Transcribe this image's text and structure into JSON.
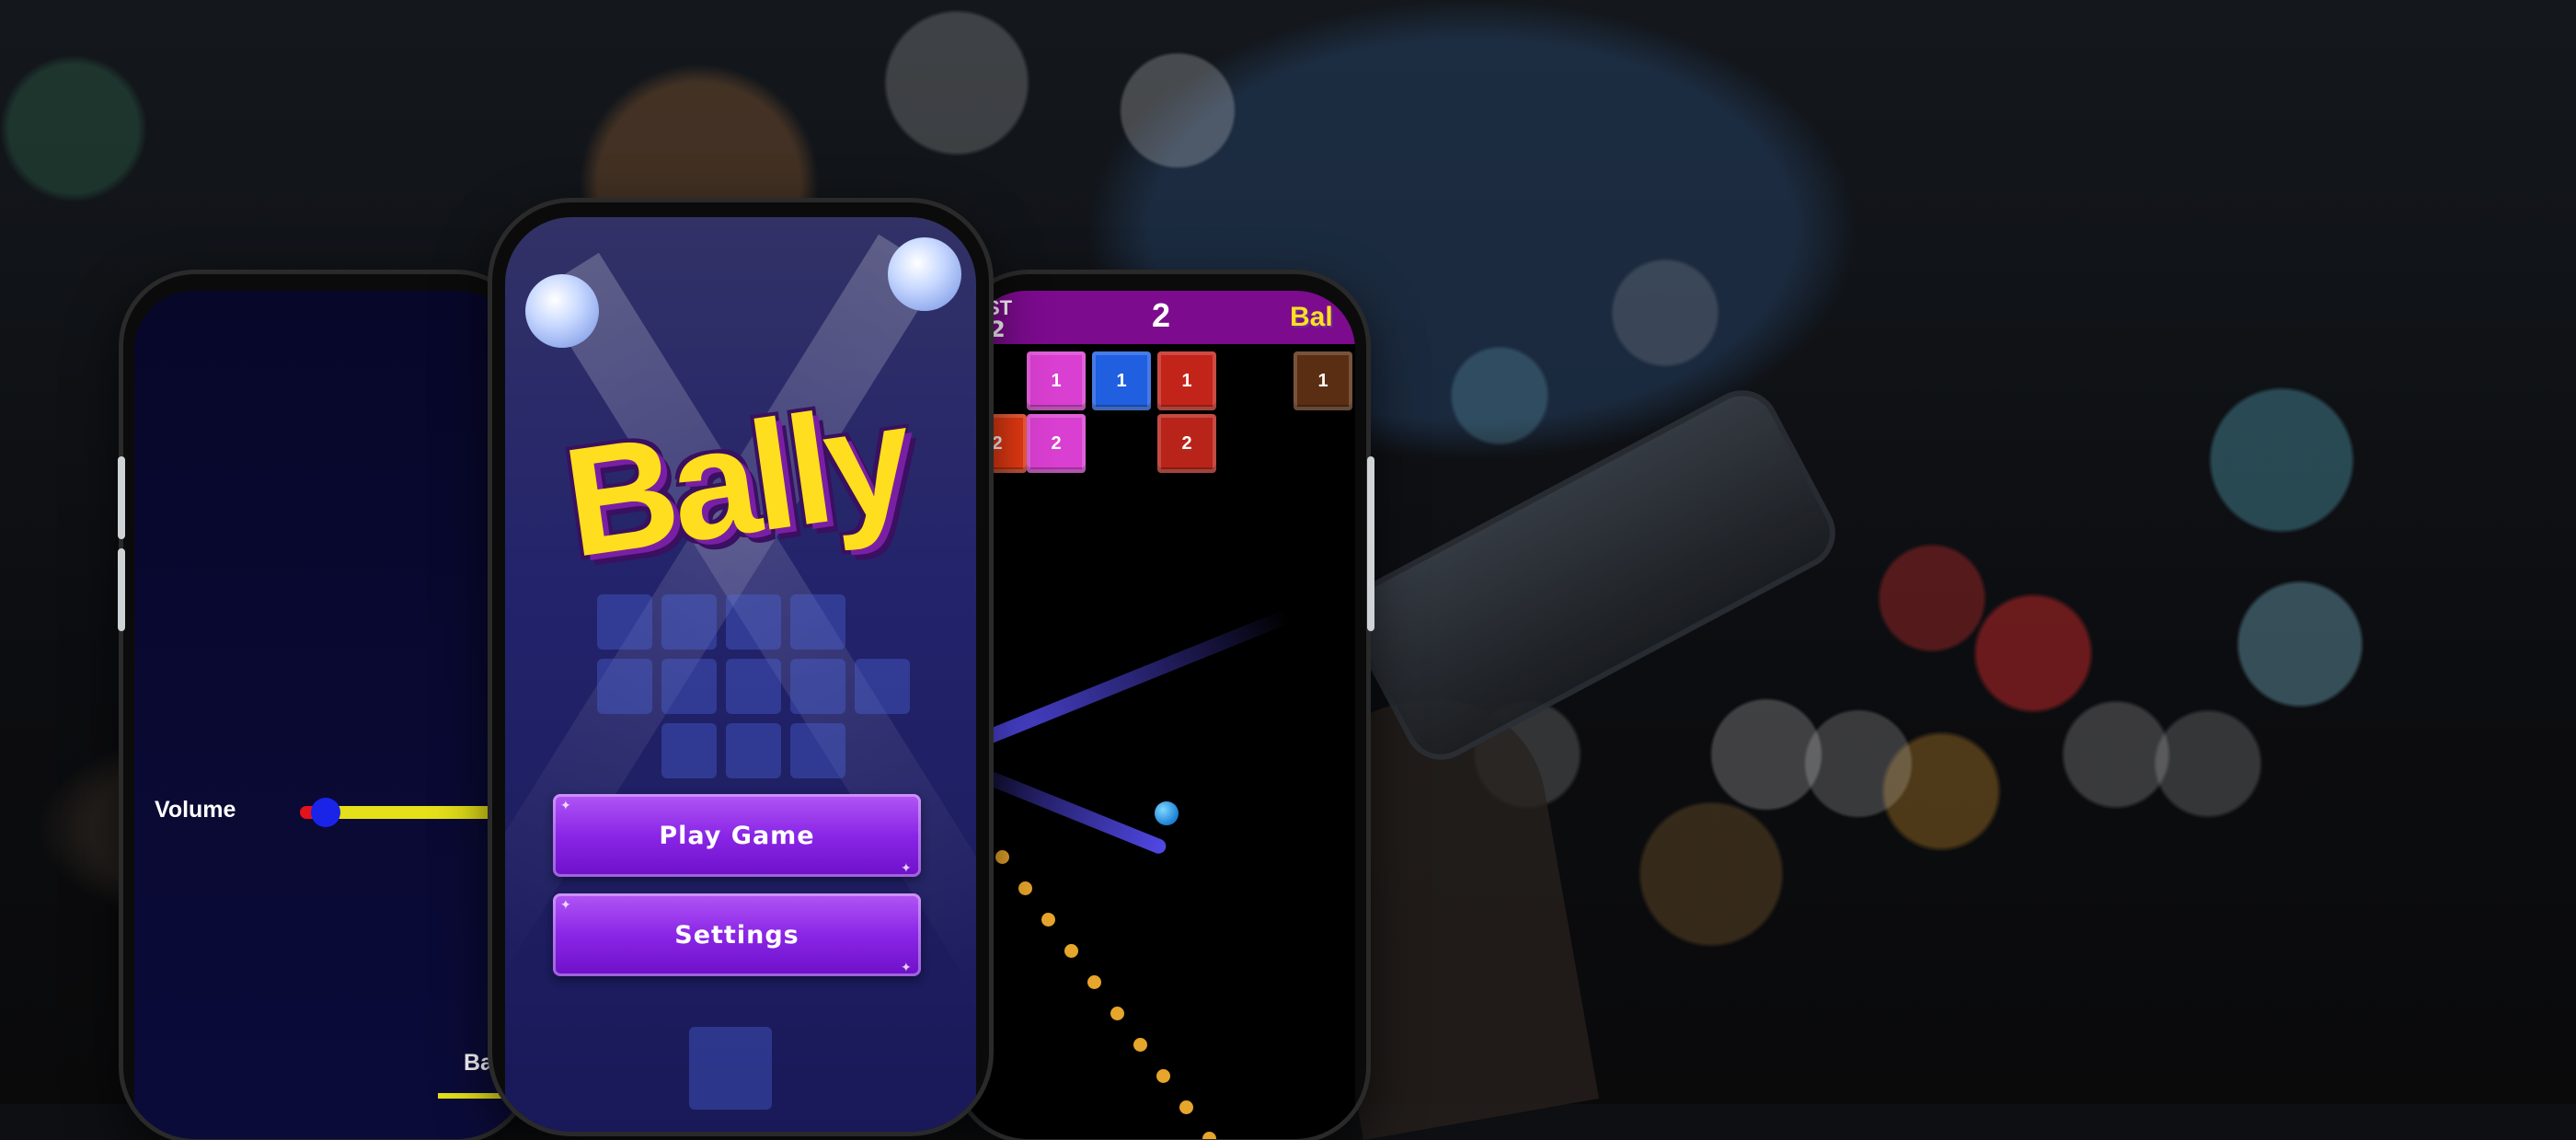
{
  "settings_screen": {
    "volume_label": "Volume",
    "volume_level_percent": 10,
    "back_label_partial": "Bac",
    "colors": {
      "slider_low": "#e4121a",
      "slider_high": "#e5e01a",
      "thumb": "#1a24e8",
      "background": "#07072a"
    }
  },
  "menu_screen": {
    "logo_text": "Bally",
    "play_button_label": "Play Game",
    "settings_button_label": "Settings",
    "colors": {
      "logo": "#ffde1f",
      "logo_outline": "#3a1060",
      "button": "#8a26e6"
    }
  },
  "game_screen": {
    "best_label_partial": "ST",
    "best_value_partial": "2",
    "score": "2",
    "logo_partial": "Bal",
    "bricks": [
      {
        "value": "1",
        "color": "#d93fd0"
      },
      {
        "value": "1",
        "color": "#1f5fe0"
      },
      {
        "value": "1",
        "color": "#c3241a"
      },
      {
        "value": "1",
        "color": "#5a2e12"
      },
      {
        "value": "2",
        "color": "#e63a12"
      },
      {
        "value": "2",
        "color": "#d93fd0"
      },
      {
        "value": "2",
        "color": "#b8241a"
      }
    ],
    "colors": {
      "header": "#7c0b8e",
      "ball": "#1b7fd6",
      "aim_dots": "#e6a52b"
    }
  }
}
